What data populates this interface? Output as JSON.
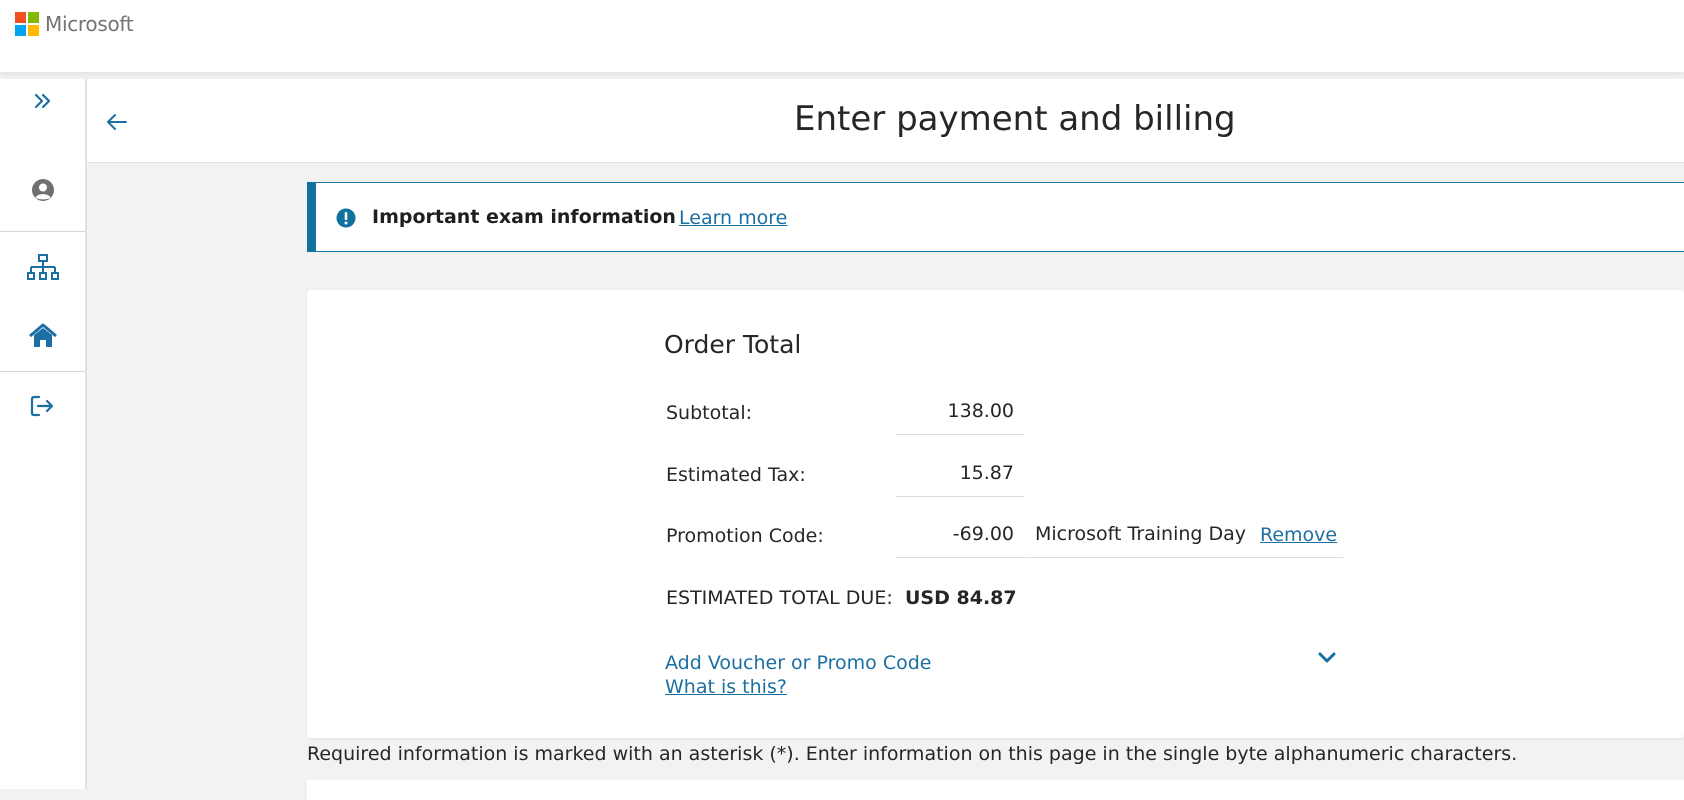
{
  "brand": {
    "name": "Microsoft",
    "logo_colors": [
      "#f25022",
      "#7fba00",
      "#00a4ef",
      "#ffb900"
    ]
  },
  "rail": {
    "items": [
      {
        "icon": "chevron-double-right-icon"
      },
      {
        "icon": "user-circle-icon"
      },
      {
        "icon": "sitemap-icon"
      },
      {
        "icon": "home-icon"
      },
      {
        "icon": "sign-out-icon"
      }
    ],
    "accent": "#1b6fa3"
  },
  "header": {
    "title": "Enter payment and billing"
  },
  "banner": {
    "icon": "exclamation-circle-icon",
    "title": "Important exam information",
    "link": "Learn more"
  },
  "order": {
    "title": "Order Total",
    "rows": [
      {
        "label": "Subtotal:",
        "value": "138.00"
      },
      {
        "label": "Estimated Tax:",
        "value": "15.87"
      },
      {
        "label": "Promotion Code:",
        "value": "-69.00",
        "promo_name": "Microsoft Training Day",
        "action": "Remove"
      }
    ],
    "total_label": "ESTIMATED TOTAL DUE:",
    "total_value": "USD 84.87",
    "voucher_link": "Add Voucher or Promo Code",
    "what_link": "What is this?",
    "expand_icon": "chevron-down-icon"
  },
  "note": "Required information is marked with an asterisk (*). Enter information on this page in the single byte alphanumeric characters."
}
